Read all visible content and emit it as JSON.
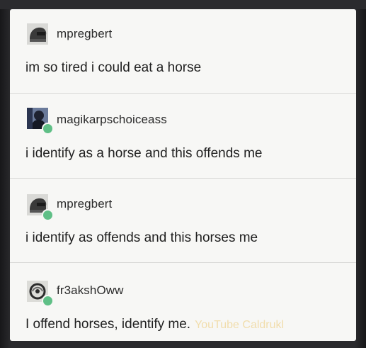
{
  "posts": [
    {
      "username": "mpregbert",
      "text": "im so tired i could eat a horse",
      "avatar_icon": "helmet-icon",
      "reblog": false
    },
    {
      "username": "magikarpschoiceass",
      "text": "i identify as a horse and this offends me",
      "avatar_icon": "dark-figure-icon",
      "reblog": true
    },
    {
      "username": "mpregbert",
      "text": "i identify as offends and this horses me",
      "avatar_icon": "helmet-icon",
      "reblog": true
    },
    {
      "username": "fr3akshOww",
      "text": "I offend horses, identify me.",
      "avatar_icon": "swirl-icon",
      "reblog": true
    }
  ],
  "watermark": "YouTube Caldrukl",
  "colors": {
    "card_background": "#f7f7f5",
    "reblog_badge": "#5fbf86",
    "text": "#1f1f1f",
    "watermark": "#f0d9a0"
  }
}
